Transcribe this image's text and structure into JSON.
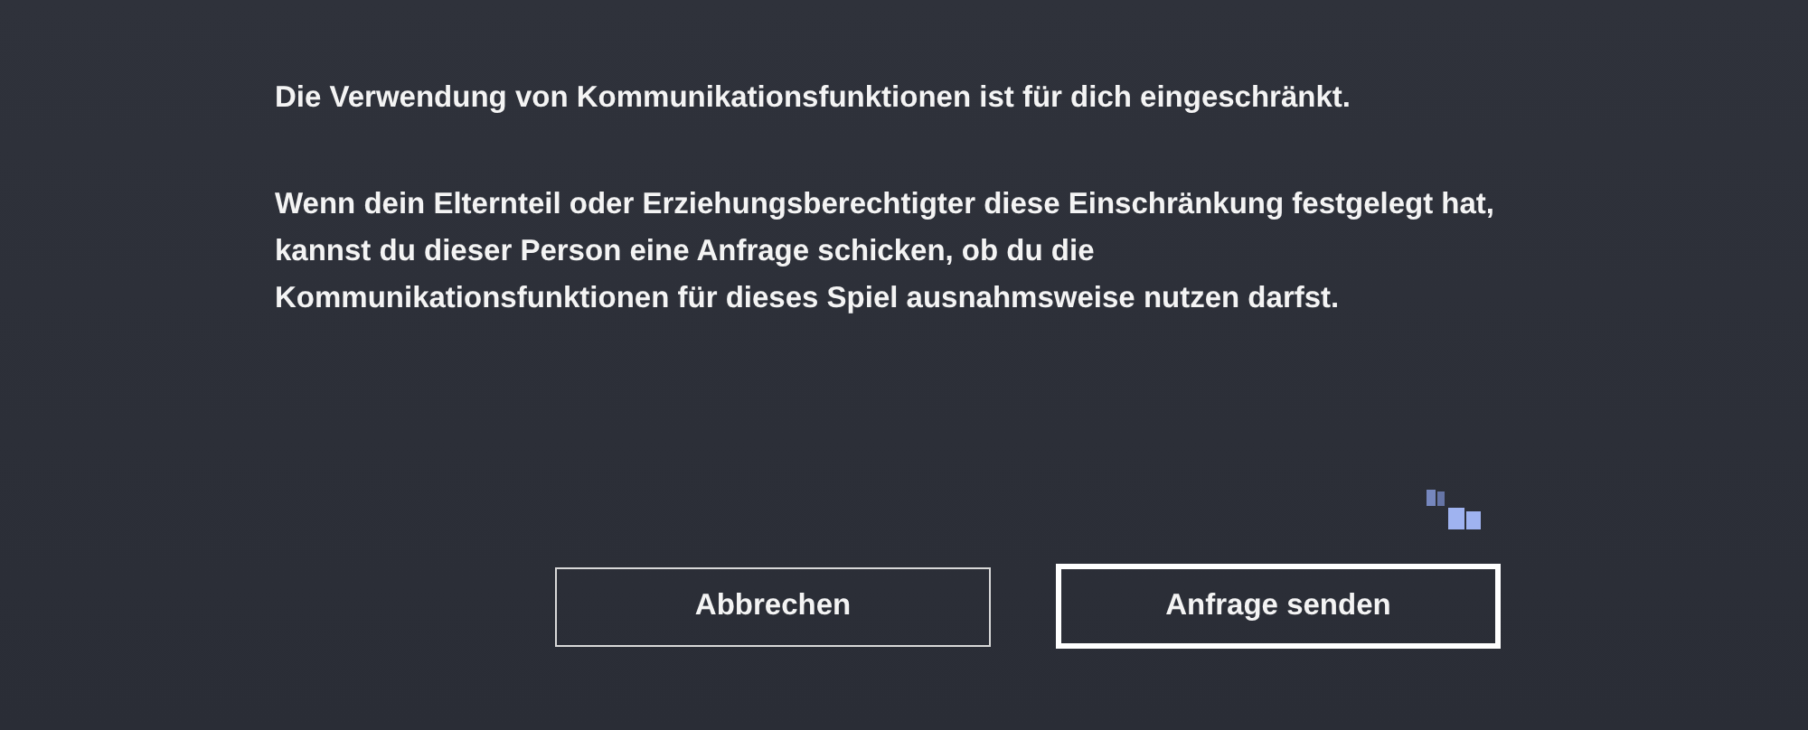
{
  "message": "Die Verwendung von Kommunikationsfunktionen ist für dich eingeschränkt.",
  "details": [
    "Wenn dein Elternteil oder Erziehungsberechtigter diese Einschränkung festgelegt hat,",
    "kannst du dieser Person eine Anfrage schicken, ob du die",
    "Kommunikationsfunktionen für dieses Spiel ausnahmsweise nutzen darfst."
  ],
  "buttons": [
    {
      "label": "Abbrechen",
      "selected": false
    },
    {
      "label": "Anfrage senden",
      "selected": true
    }
  ]
}
